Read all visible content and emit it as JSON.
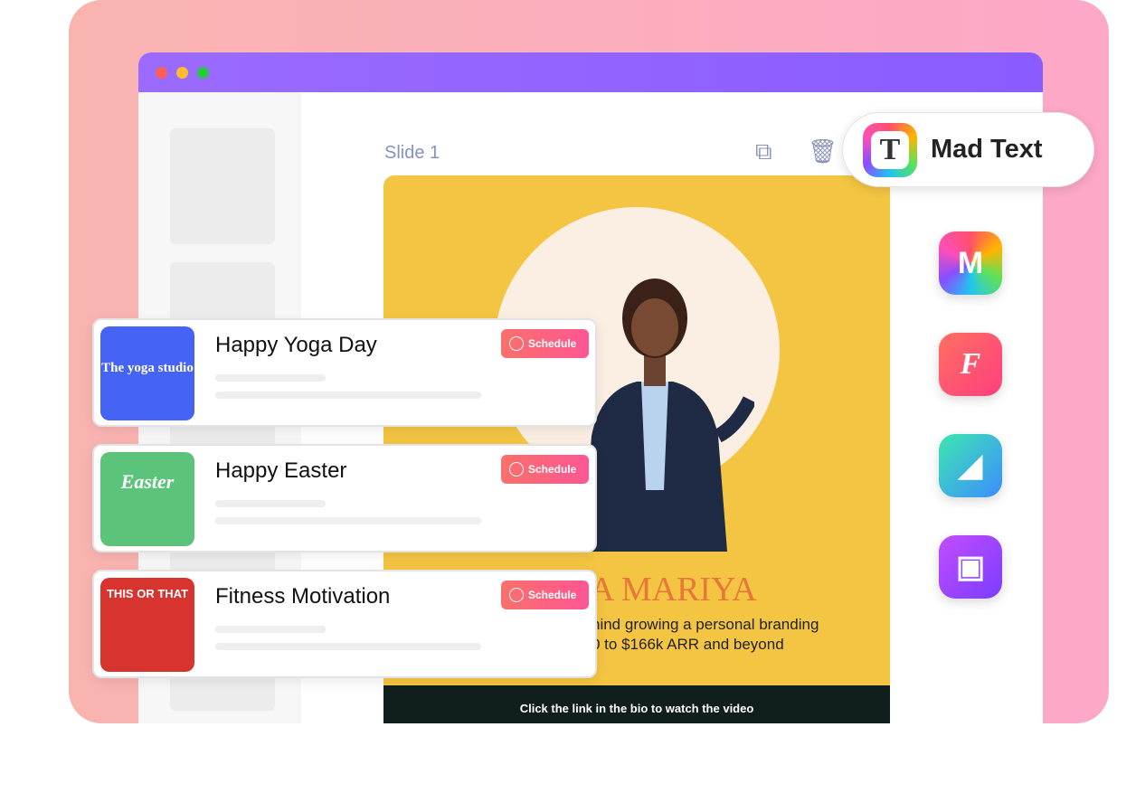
{
  "slide": {
    "label": "Slide 1",
    "name": "A MARIYA",
    "subtitle_line1": "hind growing a personal branding",
    "subtitle_line2": "0 to $166k ARR and beyond",
    "footer": "Click the link in the bio to watch the video"
  },
  "badge": {
    "title": "Mad Text",
    "logo_letter": "T"
  },
  "apps": [
    {
      "icon": "m-logo-icon",
      "glyph": "M"
    },
    {
      "icon": "font-icon",
      "glyph": "F"
    },
    {
      "icon": "paint-bucket-icon",
      "glyph": "◢"
    },
    {
      "icon": "image-search-icon",
      "glyph": "▣"
    }
  ],
  "cards": [
    {
      "title": "Happy Yoga Day",
      "button": "Schedule",
      "thumb_text": "The yoga studio"
    },
    {
      "title": "Happy Easter",
      "button": "Schedule",
      "thumb_text": "Easter"
    },
    {
      "title": "Fitness Motivation",
      "button": "Schedule",
      "thumb_text": "THIS OR THAT"
    }
  ],
  "colors": {
    "accent": "#8a5cff",
    "slide_bg": "#f4c542",
    "schedule": "#ff5e80"
  }
}
